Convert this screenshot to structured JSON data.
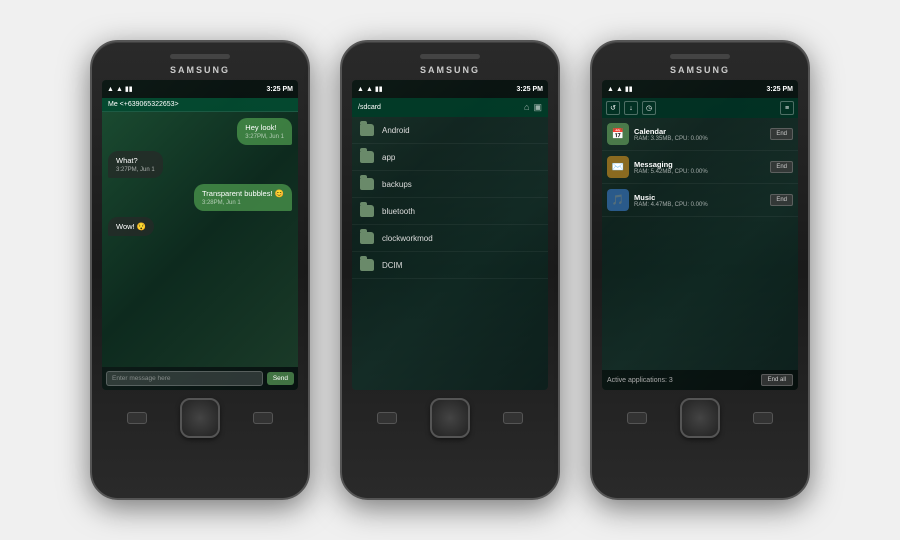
{
  "phones": [
    {
      "brand": "SAMSUNG",
      "time": "3:25 PM",
      "screen": "messaging",
      "header": {
        "contact": "Me <+639065322653>"
      },
      "messages": [
        {
          "text": "Hey look!",
          "time": "3:27PM, Jun 1",
          "side": "right"
        },
        {
          "text": "What?",
          "time": "3:27PM, Jun 1",
          "side": "left"
        },
        {
          "text": "Transparent bubbles! 😊",
          "time": "3:28PM, Jun 1",
          "side": "right"
        },
        {
          "text": "Wow! 😯",
          "time": "",
          "side": "left"
        }
      ],
      "input_placeholder": "Enter message here",
      "send_label": "Send"
    },
    {
      "brand": "SAMSUNG",
      "time": "3:25 PM",
      "screen": "files",
      "path": "/sdcard",
      "folders": [
        "Android",
        "app",
        "backups",
        "bluetooth",
        "clockworkmod",
        "DCIM"
      ]
    },
    {
      "brand": "SAMSUNG",
      "time": "3:25 PM",
      "screen": "tasks",
      "apps": [
        {
          "name": "Calendar",
          "icon": "📅",
          "icon_bg": "#4a7a4a",
          "ram": "RAM: 3.35MB, CPU: 0.00%"
        },
        {
          "name": "Messaging",
          "icon": "✉️",
          "icon_bg": "#8a6a20",
          "ram": "RAM: 5.42MB, CPU: 0.00%"
        },
        {
          "name": "Music",
          "icon": "🎵",
          "icon_bg": "#2a5a8a",
          "ram": "RAM: 4.47MB, CPU: 0.00%"
        }
      ],
      "footer": {
        "active_label": "Active applications: 3",
        "end_all_label": "End all"
      }
    }
  ]
}
